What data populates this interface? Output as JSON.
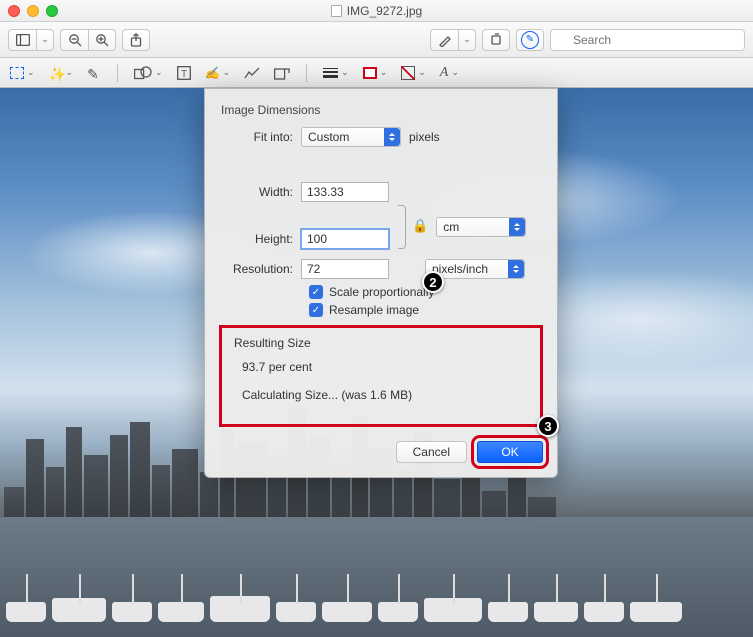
{
  "title": "IMG_9272.jpg",
  "search": {
    "placeholder": "Search"
  },
  "dialog": {
    "section_title": "Image Dimensions",
    "fitinto_label": "Fit into:",
    "fitinto_value": "Custom",
    "fitinto_unit": "pixels",
    "width_label": "Width:",
    "width_value": "133.33",
    "height_label": "Height:",
    "height_value": "100",
    "whunit_value": "cm",
    "resolution_label": "Resolution:",
    "resolution_value": "72",
    "resolution_unit_value": "pixels/inch",
    "scale_label": "Scale proportionally",
    "resample_label": "Resample image",
    "result_title": "Resulting Size",
    "result_percent": "93.7 per cent",
    "result_status": "Calculating Size... (was 1.6 MB)",
    "cancel": "Cancel",
    "ok": "OK"
  },
  "callouts": {
    "c2": "2",
    "c3": "3"
  }
}
